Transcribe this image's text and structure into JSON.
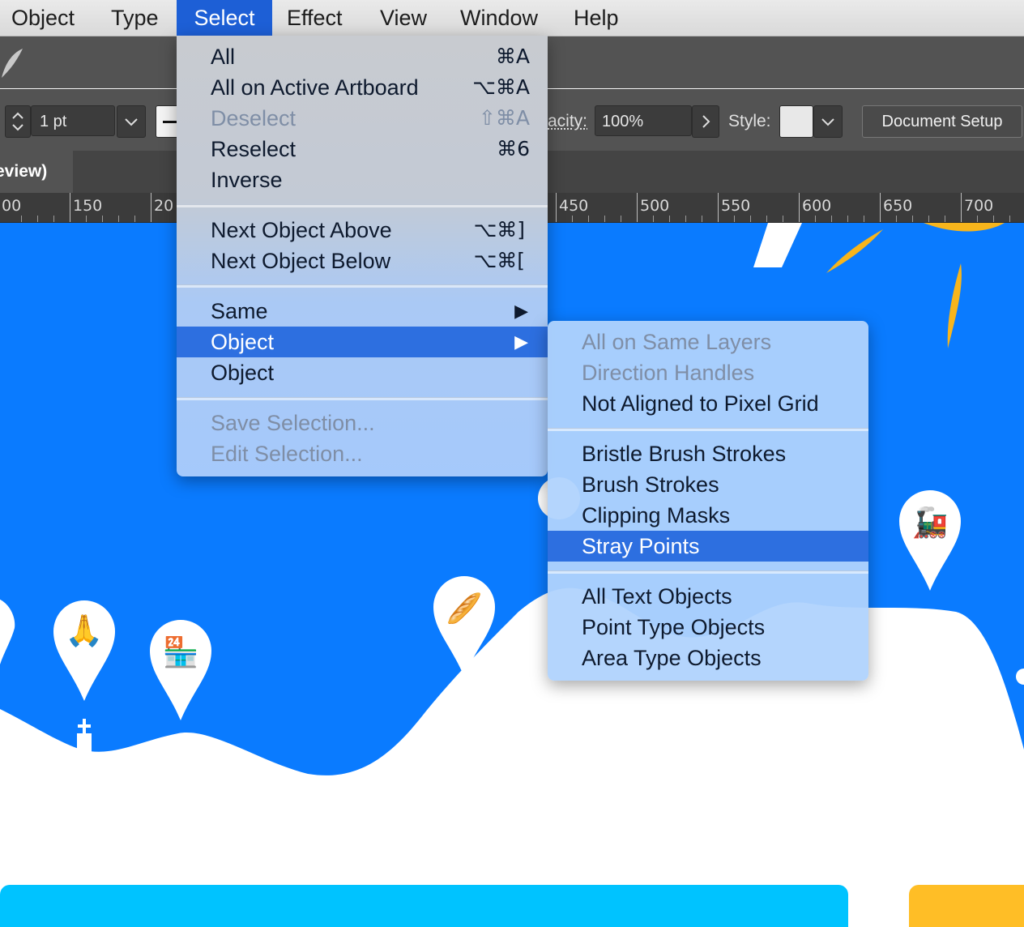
{
  "menubar": {
    "items": [
      {
        "label": "Object"
      },
      {
        "label": "Type"
      },
      {
        "label": "Select"
      },
      {
        "label": "Effect"
      },
      {
        "label": "View"
      },
      {
        "label": "Window"
      },
      {
        "label": "Help"
      }
    ]
  },
  "controlbar": {
    "stroke_weight": "1 pt",
    "opacity_label": "acity:",
    "opacity_value": "100%",
    "style_label": "Style:",
    "document_setup": "Document Setup"
  },
  "doc_tab": {
    "title": "eview)"
  },
  "ruler": {
    "labels": [
      "00",
      "150",
      "20",
      "450",
      "500",
      "550",
      "600",
      "650",
      "700"
    ]
  },
  "select_menu": {
    "items": [
      {
        "label": "All",
        "shortcut": "⌘A",
        "disabled": false
      },
      {
        "label": "All on Active Artboard",
        "shortcut": "⌥⌘A",
        "disabled": false
      },
      {
        "label": "Deselect",
        "shortcut": "⇧⌘A",
        "disabled": true
      },
      {
        "label": "Reselect",
        "shortcut": "⌘6",
        "disabled": false
      },
      {
        "label": "Inverse",
        "shortcut": "",
        "disabled": false
      },
      {
        "label": "Next Object Above",
        "shortcut": "⌥⌘]",
        "disabled": false
      },
      {
        "label": "Next Object Below",
        "shortcut": "⌥⌘[",
        "disabled": false
      },
      {
        "label": "Same",
        "shortcut": "▶",
        "disabled": false
      },
      {
        "label": "Object",
        "shortcut": "▶",
        "disabled": false,
        "highlighted": true
      },
      {
        "label": "Object",
        "shortcut": "",
        "disabled": false
      },
      {
        "label": "Save Selection...",
        "shortcut": "",
        "disabled": true
      },
      {
        "label": "Edit Selection...",
        "shortcut": "",
        "disabled": true
      }
    ]
  },
  "object_submenu": {
    "items": [
      {
        "label": "All on Same Layers",
        "disabled": true
      },
      {
        "label": "Direction Handles",
        "disabled": true
      },
      {
        "label": "Not Aligned to Pixel Grid",
        "disabled": false
      },
      {
        "label": "Bristle Brush Strokes",
        "disabled": false
      },
      {
        "label": "Brush Strokes",
        "disabled": false
      },
      {
        "label": "Clipping Masks",
        "disabled": false
      },
      {
        "label": "Stray Points",
        "disabled": false,
        "highlighted": true
      },
      {
        "label": "All Text Objects",
        "disabled": false
      },
      {
        "label": "Point Type Objects",
        "disabled": false
      },
      {
        "label": "Area Type Objects",
        "disabled": false
      }
    ]
  },
  "artwork": {
    "sky_color": "#0a7bff",
    "ground_color": "#ffffff",
    "cyan_panel": "#00c3ff",
    "yellow_panel": "#ffbe26",
    "sun_color": "#f7b51c",
    "pins": [
      {
        "emoji": "🙏",
        "name": "pray-pin"
      },
      {
        "emoji": "🏪",
        "name": "shop-pin"
      },
      {
        "emoji": "🥖",
        "name": "bread-pin"
      },
      {
        "emoji": "🚂",
        "name": "train-pin"
      }
    ]
  }
}
